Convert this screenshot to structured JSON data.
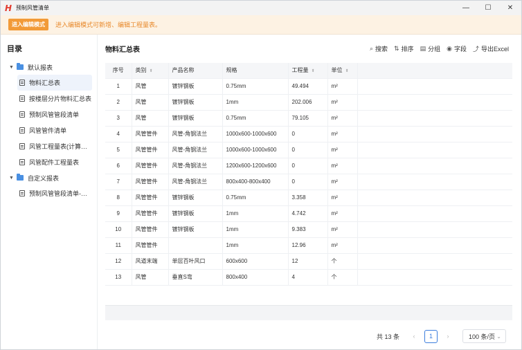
{
  "window": {
    "title": "预制风管清单",
    "logo": "H"
  },
  "notice": {
    "button": "进入编辑模式",
    "text": "进入编辑模式可新增、编辑工程量表。"
  },
  "sidebar": {
    "title": "目录",
    "groups": [
      {
        "label": "默认报表",
        "items": [
          "物料汇总表",
          "按楼层分片物料汇总表",
          "预制风管管段清单",
          "风管管件清单",
          "风管工程量表(计算…",
          "风管配件工程量表"
        ]
      },
      {
        "label": "自定义报表",
        "items": [
          "预制风管管段清单-…"
        ]
      }
    ]
  },
  "main": {
    "title": "物料汇总表",
    "toolbar": {
      "search": "搜索",
      "sort": "排序",
      "group": "分组",
      "fields": "字段",
      "export": "导出Excel"
    },
    "columns": [
      "序号",
      "类别",
      "产品名称",
      "规格",
      "工程量",
      "单位"
    ],
    "rows": [
      [
        "1",
        "风管",
        "镀锌钢板",
        "0.75mm",
        "49.494",
        "m²"
      ],
      [
        "2",
        "风管",
        "镀锌钢板",
        "1mm",
        "202.006",
        "m²"
      ],
      [
        "3",
        "风管",
        "镀锌钢板",
        "0.75mm",
        "79.105",
        "m²"
      ],
      [
        "4",
        "风管管件",
        "风管-角钢法兰",
        "1000x600-1000x600",
        "0",
        "m²"
      ],
      [
        "5",
        "风管管件",
        "风管-角钢法兰",
        "1000x600-1000x600",
        "0",
        "m²"
      ],
      [
        "6",
        "风管管件",
        "风管-角钢法兰",
        "1200x600-1200x600",
        "0",
        "m²"
      ],
      [
        "7",
        "风管管件",
        "风管-角钢法兰",
        "800x400-800x400",
        "0",
        "m²"
      ],
      [
        "8",
        "风管管件",
        "镀锌钢板",
        "0.75mm",
        "3.358",
        "m²"
      ],
      [
        "9",
        "风管管件",
        "镀锌钢板",
        "1mm",
        "4.742",
        "m²"
      ],
      [
        "10",
        "风管管件",
        "镀锌钢板",
        "1mm",
        "9.383",
        "m²"
      ],
      [
        "11",
        "风管管件",
        "",
        "1mm",
        "12.96",
        "m²"
      ],
      [
        "12",
        "风道末端",
        "单层百叶风口",
        "600x600",
        "12",
        "个"
      ],
      [
        "13",
        "风管",
        "垂直S弯",
        "800x400",
        "4",
        "个"
      ]
    ]
  },
  "pager": {
    "total": "共 13 条",
    "page": "1",
    "size": "100 条/页"
  }
}
